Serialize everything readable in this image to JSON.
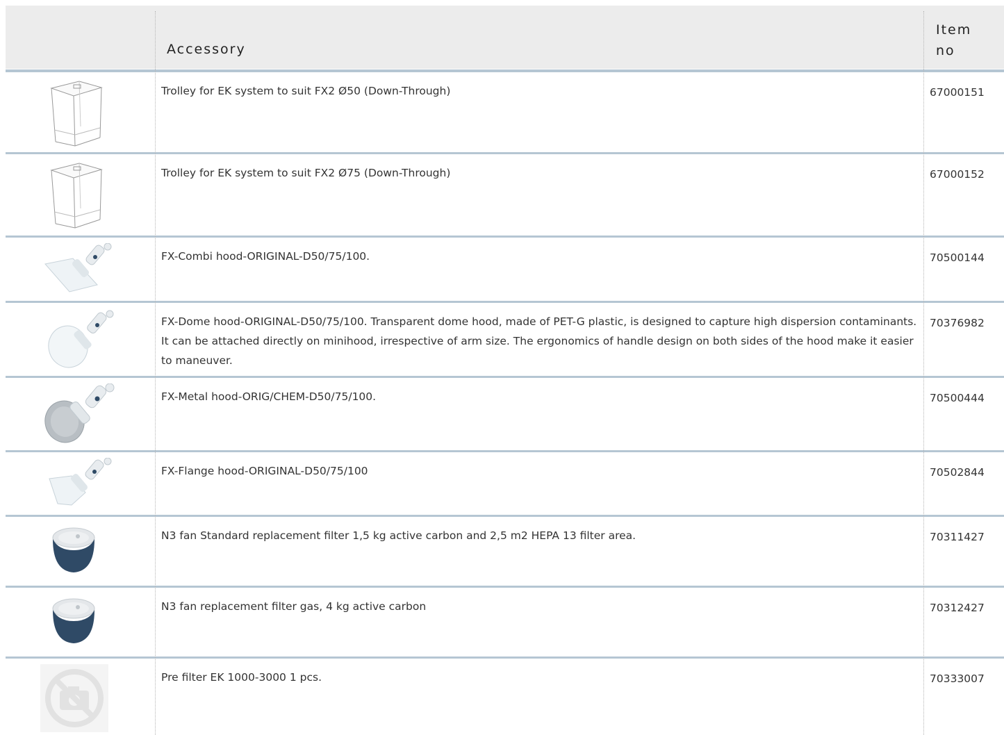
{
  "header": {
    "col_image": "",
    "col_accessory": "Accessory",
    "col_item_line1": "Item",
    "col_item_line2": "no"
  },
  "rows": [
    {
      "icon": "trolley-icon",
      "description": "Trolley for EK system to suit FX2 Ø50 (Down-Through)",
      "item_no": "67000151"
    },
    {
      "icon": "trolley-icon",
      "description": "Trolley for EK system to suit FX2 Ø75 (Down-Through)",
      "item_no": "67000152"
    },
    {
      "icon": "combi-hood-icon",
      "description": "FX-Combi hood-ORIGINAL-D50/75/100.",
      "item_no": "70500144"
    },
    {
      "icon": "dome-hood-icon",
      "description": "FX-Dome hood-ORIGINAL-D50/75/100. Transparent dome hood, made of PET-G plastic, is designed to capture high dispersion contaminants. It can be attached directly on minihood, irrespective of arm size. The ergonomics of handle design on both sides of the hood make it easier to maneuver.",
      "item_no": "70376982"
    },
    {
      "icon": "metal-hood-icon",
      "description": "FX-Metal hood-ORIG/CHEM-D50/75/100.",
      "item_no": "70500444"
    },
    {
      "icon": "flange-hood-icon",
      "description": "FX-Flange hood-ORIGINAL-D50/75/100",
      "item_no": "70502844"
    },
    {
      "icon": "filter-icon",
      "description": "N3 fan Standard replacement filter 1,5 kg active carbon and 2,5 m2 HEPA 13 filter area.",
      "item_no": "70311427"
    },
    {
      "icon": "filter-icon",
      "description": "N3 fan replacement filter gas, 4 kg active carbon",
      "item_no": "70312427"
    },
    {
      "icon": "no-image-icon",
      "description": "Pre filter EK 1000-3000 1 pcs.",
      "item_no": "70333007"
    }
  ],
  "colors": {
    "header_bg": "#ececec",
    "rule": "#b5c6d3",
    "filter_body": "#2f4a66"
  }
}
